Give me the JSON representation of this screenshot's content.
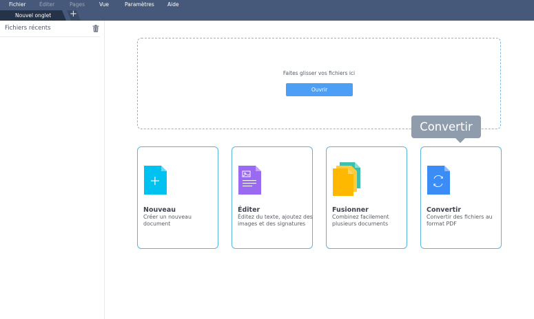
{
  "menu": {
    "items": [
      {
        "label": "Fichier",
        "enabled": true
      },
      {
        "label": "Éditer",
        "enabled": false
      },
      {
        "label": "Pages",
        "enabled": false
      },
      {
        "label": "Vue",
        "enabled": true
      },
      {
        "label": "Paramètres",
        "enabled": true
      },
      {
        "label": "Aide",
        "enabled": true
      }
    ]
  },
  "tabs": {
    "active_label": "Nouvel onglet",
    "add_label": "+"
  },
  "sidebar": {
    "title": "Fichiers récents",
    "trash_icon": "trash-icon"
  },
  "dropzone": {
    "text": "Faites glisser vos fichiers ici",
    "button_label": "Ouvrir"
  },
  "cards": [
    {
      "title": "Nouveau",
      "desc": "Créer un nouveau document",
      "icon": "new-document-icon",
      "color": "#00c2f0"
    },
    {
      "title": "Éditer",
      "desc": "Éditez du texte, ajoutez des images et des signatures",
      "icon": "edit-document-icon",
      "color": "#9b6af2"
    },
    {
      "title": "Fusionner",
      "desc": "Combinez facilement plusieurs documents",
      "icon": "merge-documents-icon",
      "color": "#ffb800"
    },
    {
      "title": "Convertir",
      "desc": "Convertir des fichiers au format PDF",
      "icon": "convert-document-icon",
      "color": "#3b8cf5"
    }
  ],
  "tooltip": {
    "text": "Convertir"
  },
  "colors": {
    "menubar": "#46597a",
    "active_tab": "#253349",
    "accent": "#4d9ef5",
    "card_border": "#58b4df"
  }
}
